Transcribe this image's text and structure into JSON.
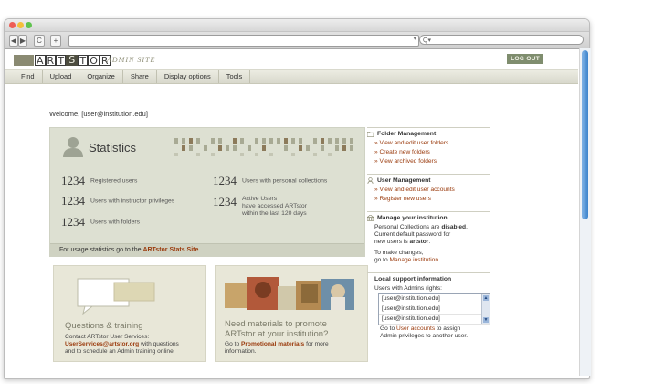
{
  "browser": {
    "back": "◀",
    "forward": "▶",
    "reload": "C",
    "add": "+",
    "search_placeholder": "Q▾"
  },
  "header": {
    "logo_letters": [
      "A",
      "R",
      "T",
      "S",
      "T",
      "O",
      "R"
    ],
    "site_label": "ADMIN SITE",
    "logout": "LOG OUT"
  },
  "nav": [
    "Find",
    "Upload",
    "Organize",
    "Share",
    "Display options",
    "Tools"
  ],
  "welcome": "Welcome, [user@institution.edu]",
  "statistics": {
    "title": "Statistics",
    "rows": [
      {
        "num": "1234",
        "label": "Registered users"
      },
      {
        "num": "1234",
        "label": "Users with instructor privileges"
      },
      {
        "num": "1234",
        "label": "Users with folders"
      },
      {
        "num": "1234",
        "label": "Users with personal collections"
      },
      {
        "num": "1234",
        "label_lines": [
          "Active Users",
          "have accessed ARTstor",
          "within the last 120 days"
        ]
      }
    ],
    "footer_text": "For usage statistics go to the ",
    "footer_link": "ARTstor Stats Site"
  },
  "questions": {
    "title": "Questions & training",
    "line1": "Contact ARTstor User Services:",
    "email": "UserServices@artstor.org",
    "line2": " with questions",
    "line3": "and to schedule an Admin training online."
  },
  "promo": {
    "title_line1": "Need materials to promote",
    "title_line2": "ARTstor at your institution?",
    "text1": "Go to ",
    "link": "Promotional materials",
    "text2": " for more",
    "text3": "information."
  },
  "sidebar": {
    "folder_mgmt": {
      "title": "Folder Management",
      "links": [
        "» View and edit user folders",
        "» Create new folders",
        "» View archived folders"
      ]
    },
    "user_mgmt": {
      "title": "User Management",
      "links": [
        "» View and edit user accounts",
        "» Register new users"
      ]
    },
    "manage_inst": {
      "title": "Manage your institution",
      "line1a": "Personal Collections are ",
      "line1b": "disabled",
      "line1c": ".",
      "line2": "Current default password for",
      "line3a": "new users is ",
      "line3b": "artstor",
      "line3c": ".",
      "line4": "To make changes,",
      "line5a": "go to ",
      "line5b": "Manage institution",
      "line5c": "."
    },
    "local_support": {
      "title": "Local support information",
      "subtitle": "Users with Admins rights:",
      "users": [
        "[user@institution.edu]",
        "[user@institution.edu]",
        "[user@institution.edu]"
      ],
      "foot1a": "Go to ",
      "foot1b": "User accounts",
      "foot1c": " to assign",
      "foot2": "Admin privileges to another user."
    }
  },
  "colors": {
    "accent_link": "#9a3a0c",
    "stats_bg": "#dde0d2",
    "box_bg": "#e8e7d8",
    "nav_bg": "#d8d8cc"
  }
}
